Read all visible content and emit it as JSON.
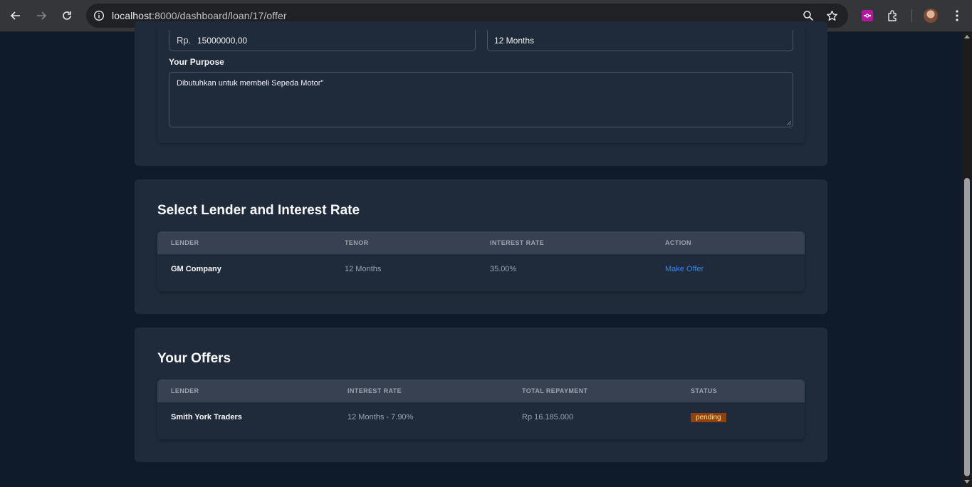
{
  "browser": {
    "url_host": "localhost",
    "url_path": ":8000/dashboard/loan/17/offer"
  },
  "loan_form": {
    "currency_prefix": "Rp.",
    "amount": "15000000,00",
    "tenor": "12 Months",
    "purpose_label": "Your Purpose",
    "purpose_value": "Dibutuhkan untuk membeli Sepeda Motor\""
  },
  "lenders_section": {
    "title": "Select Lender and Interest Rate",
    "columns": [
      "LENDER",
      "TENOR",
      "INTEREST RATE",
      "ACTION"
    ],
    "rows": [
      {
        "lender": "GM Company",
        "tenor": "12 Months",
        "interest_rate": "35.00%",
        "action": "Make Offer"
      }
    ]
  },
  "offers_section": {
    "title": "Your Offers",
    "columns": [
      "LENDER",
      "INTEREST RATE",
      "TOTAL REPAYMENT",
      "STATUS"
    ],
    "rows": [
      {
        "lender": "Smith York Traders",
        "interest_rate": "12 Months - 7.90%",
        "total_repayment": "Rp 16.185.000",
        "status": "pending"
      }
    ]
  },
  "colors": {
    "page_bg": "#0f1a2b",
    "card_bg": "#1f2a3b",
    "table_header_bg": "#374151",
    "link": "#3b82f6",
    "badge_bg": "#92400e",
    "badge_text": "#fde68a"
  }
}
